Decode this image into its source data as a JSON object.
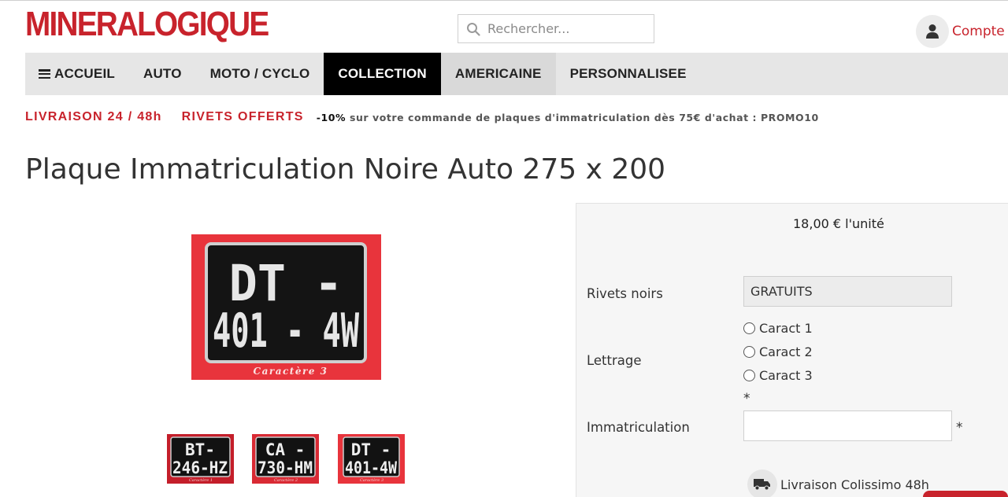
{
  "header": {
    "logo_text": "MINERALOGIQUE",
    "search_placeholder": "Rechercher...",
    "search_icon": "search-icon",
    "account_label": "Compte",
    "account_icon": "user-icon"
  },
  "nav": {
    "items": [
      {
        "label": "ACCUEIL",
        "icon": "menu-icon"
      },
      {
        "label": "AUTO"
      },
      {
        "label": "MOTO / CYCLO"
      },
      {
        "label": "COLLECTION",
        "state": "active"
      },
      {
        "label": "AMERICAINE",
        "state": "hover"
      },
      {
        "label": "PERSONNALISEE"
      }
    ]
  },
  "promo": {
    "delivery": "LIVRAISON 24 / 48h",
    "rivets": "RIVETS OFFERTS",
    "discount_bold": "-10%",
    "discount_text": " sur votre commande de plaques d'immatriculation dès 75€ d'achat : PROMO10"
  },
  "product": {
    "title": "Plaque Immatriculation Noire Auto 275 x 200",
    "main_image": {
      "line1": "DT -",
      "line2": "401 - 4W",
      "caption": "Caractère 3"
    },
    "thumbnails": [
      {
        "line1": "BT-",
        "line2": "246-HZ",
        "caption": "Caractère 1"
      },
      {
        "line1": "CA -",
        "line2": "730-HM",
        "caption": "Caractère 2"
      },
      {
        "line1": "DT -",
        "line2": "401-4W",
        "caption": "Caractère 3"
      }
    ]
  },
  "options": {
    "price": "18,00 €",
    "price_unit": "l'unité",
    "rivets_label": "Rivets noirs",
    "rivets_value": "GRATUITS",
    "lettering_label": "Lettrage",
    "lettering_options": [
      "Caract 1",
      "Caract 2",
      "Caract 3"
    ],
    "required_mark": "*",
    "immat_label": "Immatriculation",
    "immat_value": "",
    "shipping_label": "Livraison Colissimo 48h",
    "shipping_icon": "truck-icon"
  },
  "colors": {
    "brand_red": "#c8232c",
    "nav_bg": "#e6e6e6",
    "nav_active": "#000000",
    "plate_bg": "#e8343c"
  }
}
